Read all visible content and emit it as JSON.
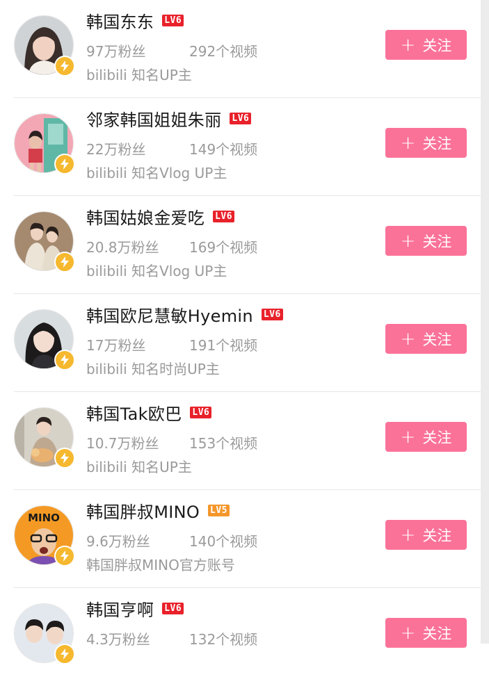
{
  "colors": {
    "accent": "#fb7299",
    "level6": "#e8212a",
    "level5": "#f5962a",
    "badge": "#f5b82e"
  },
  "users": [
    {
      "name": "韩国东东",
      "level": "LV6",
      "level_color": "#e8212a",
      "fans": "97万粉丝",
      "videos": "292个视频",
      "desc": "bilibili 知名UP主",
      "follow_label": "关注",
      "avatar_icon": "avatar-woman-portrait",
      "avatar_bg": "#cfd3d6"
    },
    {
      "name": "邻家韩国姐姐朱丽",
      "level": "LV6",
      "level_color": "#e8212a",
      "fans": "22万粉丝",
      "videos": "149个视频",
      "desc": "bilibili 知名Vlog UP主",
      "follow_label": "关注",
      "avatar_icon": "avatar-colorful-storefront",
      "avatar_bg": "#f3a7b4"
    },
    {
      "name": "韩国姑娘金爱吃",
      "level": "LV6",
      "level_color": "#e8212a",
      "fans": "20.8万粉丝",
      "videos": "169个视频",
      "desc": "bilibili 知名Vlog UP主",
      "follow_label": "关注",
      "avatar_icon": "avatar-couple-beige",
      "avatar_bg": "#a58a70"
    },
    {
      "name": "韩国欧尼慧敏Hyemin",
      "level": "LV6",
      "level_color": "#e8212a",
      "fans": "17万粉丝",
      "videos": "191个视频",
      "desc": "bilibili 知名时尚UP主",
      "follow_label": "关注",
      "avatar_icon": "avatar-woman-dark-hair",
      "avatar_bg": "#d8dde0"
    },
    {
      "name": "韩国Tak欧巴",
      "level": "LV6",
      "level_color": "#e8212a",
      "fans": "10.7万粉丝",
      "videos": "153个视频",
      "desc": "bilibili 知名UP主",
      "follow_label": "关注",
      "avatar_icon": "avatar-man-with-dog",
      "avatar_bg": "#d7d2c8"
    },
    {
      "name": "韩国胖叔MINO",
      "level": "LV5",
      "level_color": "#f5962a",
      "fans": "9.6万粉丝",
      "videos": "140个视频",
      "desc": "韩国胖叔MINO官方账号",
      "follow_label": "关注",
      "avatar_icon": "avatar-mino-orange",
      "avatar_bg": "#f49a24",
      "avatar_text": "MINO"
    },
    {
      "name": "韩国亨啊",
      "level": "LV6",
      "level_color": "#e8212a",
      "fans": "4.3万粉丝",
      "videos": "132个视频",
      "desc": "",
      "follow_label": "关注",
      "avatar_icon": "avatar-two-men",
      "avatar_bg": "#e3e8ee"
    }
  ]
}
